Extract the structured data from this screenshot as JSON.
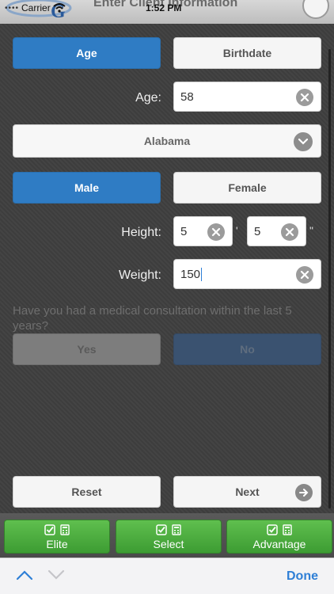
{
  "status_bar": {
    "carrier": "Carrier",
    "time": "1:52 PM"
  },
  "header": {
    "title": "Enter Client Information"
  },
  "mode_toggle": {
    "age_label": "Age",
    "birthdate_label": "Birthdate",
    "selected": "Age"
  },
  "age_field": {
    "label": "Age:",
    "value": "58"
  },
  "state_select": {
    "value": "Alabama"
  },
  "gender_toggle": {
    "male_label": "Male",
    "female_label": "Female",
    "selected": "Male"
  },
  "height": {
    "label": "Height:",
    "feet": "5",
    "inches": "5",
    "feet_unit": "'",
    "inches_unit": "\""
  },
  "weight": {
    "label": "Weight:",
    "value": "150"
  },
  "consultation": {
    "question": "Have you had a medical consultation within the last 5 years?",
    "yes_label": "Yes",
    "no_label": "No"
  },
  "actions": {
    "reset_label": "Reset",
    "next_label": "Next"
  },
  "tabs": [
    {
      "label": "Elite"
    },
    {
      "label": "Select"
    },
    {
      "label": "Advantage"
    }
  ],
  "keyboard_toolbar": {
    "done_label": "Done"
  },
  "colors": {
    "accent_blue": "#2f7cc4",
    "tab_green": "#4cae3f",
    "done_blue": "#2e7fd6"
  }
}
